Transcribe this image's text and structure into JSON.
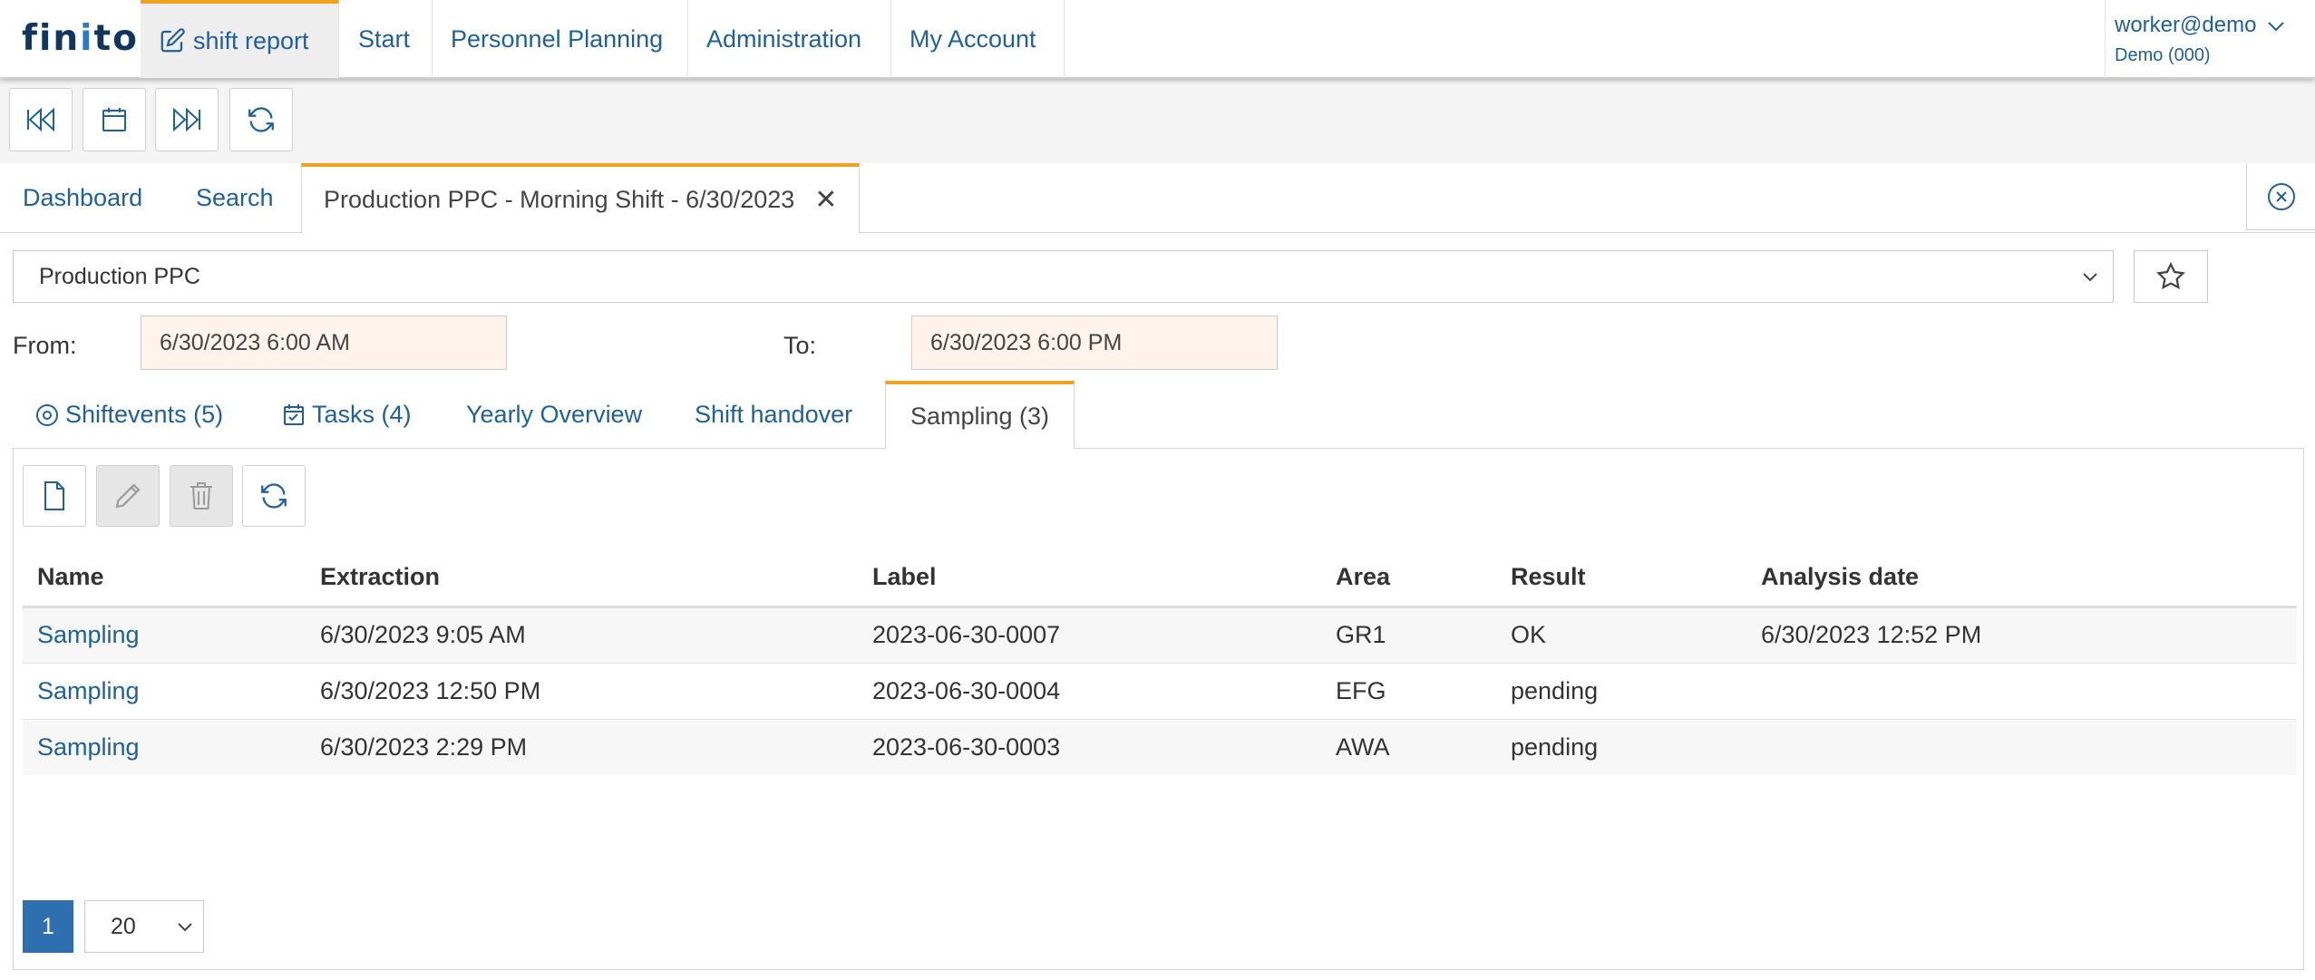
{
  "colors": {
    "accent": "#f0a21e",
    "link": "#1f5f9c",
    "primary": "#2e6faf",
    "date_bg": "#fff3ec"
  },
  "app": {
    "logo_a": "fin",
    "logo_b": "i",
    "logo_c": "to"
  },
  "nav": {
    "shift_report": "shift report",
    "start": "Start",
    "personnel": "Personnel Planning",
    "admin": "Administration",
    "account": "My Account"
  },
  "user": {
    "name": "worker@demo",
    "org": "Demo (000)"
  },
  "toolbar": {
    "icons": [
      "rewind-icon",
      "calendar-icon",
      "fast-forward-icon",
      "refresh-icon"
    ]
  },
  "doctabs": {
    "dashboard": "Dashboard",
    "search": "Search",
    "active": "Production PPC - Morning Shift - 6/30/2023",
    "close": "✕"
  },
  "area": {
    "selected": "Production PPC"
  },
  "range": {
    "from_label": "From:",
    "from_value": "6/30/2023 6:00 AM",
    "to_label": "To:",
    "to_value": "6/30/2023 6:00 PM"
  },
  "subtabs": {
    "shiftevents": "Shiftevents (5)",
    "tasks": "Tasks (4)",
    "yearly": "Yearly Overview",
    "handover": "Shift handover",
    "sampling": "Sampling (3)"
  },
  "table": {
    "headers": [
      "Name",
      "Extraction",
      "Label",
      "Area",
      "Result",
      "Analysis date"
    ],
    "rows": [
      [
        "Sampling",
        "6/30/2023 9:05 AM",
        "2023-06-30-0007",
        "GR1",
        "OK",
        "6/30/2023 12:52 PM"
      ],
      [
        "Sampling",
        "6/30/2023 12:50 PM",
        "2023-06-30-0004",
        "EFG",
        "pending",
        ""
      ],
      [
        "Sampling",
        "6/30/2023 2:29 PM",
        "2023-06-30-0003",
        "AWA",
        "pending",
        ""
      ]
    ]
  },
  "pager": {
    "current": "1",
    "size": "20"
  }
}
